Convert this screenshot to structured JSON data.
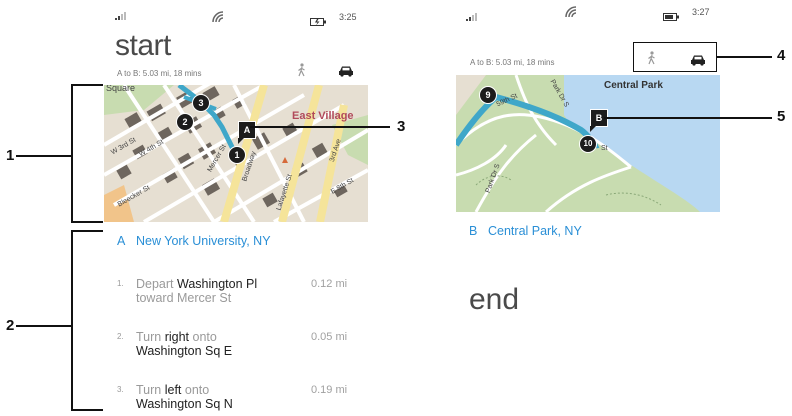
{
  "left_phone": {
    "status": {
      "time": "3:25"
    },
    "title": "start",
    "route_summary": "A to B: 5.03 mi, 18 mins",
    "map": {
      "labels": {
        "square": "Square",
        "east_village": "East Village",
        "w3rd": "W 3rd St",
        "w4th": "W 4th St",
        "mercer": "Mercer St",
        "broadway": "Broadway",
        "lafayette": "Lafayette St",
        "third_ave": "3rd Ave",
        "e8th": "E 8th St",
        "bleecker": "Bleecker St"
      },
      "markers": {
        "a": "A",
        "m1": "1",
        "m2": "2",
        "m3": "3"
      }
    },
    "start_point": {
      "letter": "A",
      "name": "New York University, NY"
    },
    "steps": [
      {
        "num": "1.",
        "pre": "Depart ",
        "strong": "Washington Pl",
        "post": "toward Mercer St",
        "line2_strong": "",
        "dist": "0.12 mi"
      },
      {
        "num": "2.",
        "pre": "Turn ",
        "strong": "right",
        "post": " onto",
        "line2_strong": "Washington Sq E",
        "dist": "0.05 mi"
      },
      {
        "num": "3.",
        "pre": "Turn ",
        "strong": "left",
        "post": " onto",
        "line2_strong": "Washington Sq N",
        "dist": "0.19 mi"
      }
    ]
  },
  "right_phone": {
    "status": {
      "time": "3:27"
    },
    "route_summary": "A to B: 5.03 mi, 18 mins",
    "map": {
      "labels": {
        "central_park": "Central Park",
        "w59th": "59th St",
        "park_dr_s": "Park Dr S",
        "st": "St"
      },
      "markers": {
        "b": "B",
        "m9": "9",
        "m10": "10"
      }
    },
    "end_point": {
      "letter": "B",
      "name": "Central Park, NY"
    },
    "end_title": "end"
  },
  "callouts": [
    "1",
    "2",
    "3",
    "4",
    "5"
  ],
  "colors": {
    "accent": "#2a8fd6",
    "park": "#c8dcb0",
    "water": "#b8d8f2",
    "road_yellow": "#f5e49a",
    "route": "#3fa7c9",
    "building": "#6e665e"
  }
}
